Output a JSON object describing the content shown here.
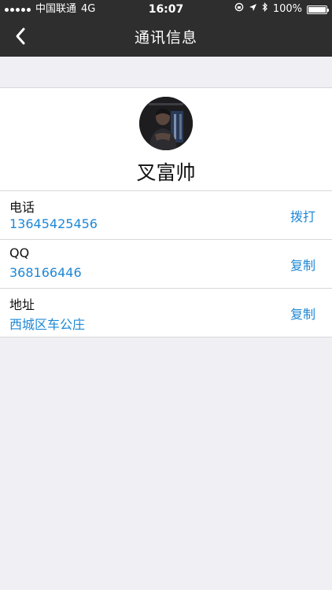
{
  "status_bar": {
    "carrier": "中国联通",
    "network": "4G",
    "time": "16:07",
    "battery": "100%",
    "battery_level": 1.0
  },
  "nav": {
    "title": "通讯信息"
  },
  "contact": {
    "name": "叉富帅",
    "rows": [
      {
        "label": "电话",
        "value": "13645425456",
        "action": "拨打"
      },
      {
        "label": "QQ",
        "value": "368166446",
        "action": "复制"
      },
      {
        "label": "地址",
        "value": "西城区车公庄",
        "action": "复制"
      }
    ]
  },
  "colors": {
    "accent": "#1e88d6",
    "navbar_bg": "#2e2e2e",
    "page_bg": "#efeff4"
  },
  "icons": {
    "back": "chevron-left-icon",
    "signal": "signal-dots-icon",
    "lock_rotation": "orientation-lock-icon",
    "location": "location-arrow-icon",
    "bluetooth": "bluetooth-icon",
    "battery": "battery-icon"
  }
}
